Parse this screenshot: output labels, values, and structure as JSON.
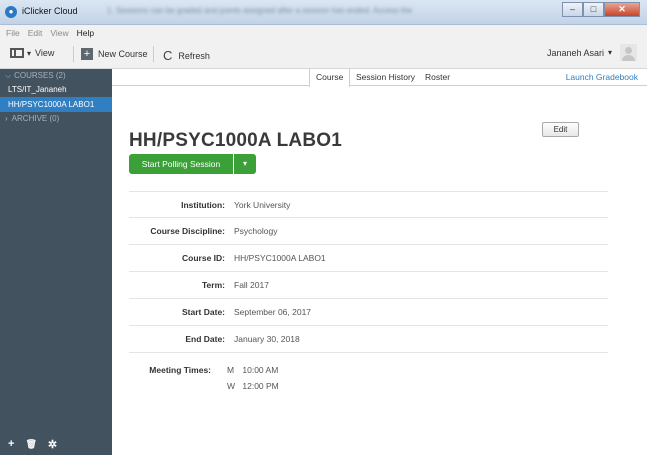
{
  "window": {
    "title": "iClicker Cloud",
    "app_icon": "iclicker-logo-icon",
    "blurred_notice": "1. Sessions can be graded and points assigned after a session has ended. Access the",
    "minimize": "‒",
    "maximize": "□",
    "close": "✕"
  },
  "menu": [
    "File",
    "Edit",
    "View",
    "Help"
  ],
  "toolbar": {
    "view_label": "View",
    "view_caret": "▾",
    "new_course_label": "New Course",
    "new_course_icon": "+",
    "refresh_label": "Refresh",
    "refresh_icon": "C",
    "user_name": "Jananeh Asari",
    "user_caret": "▾"
  },
  "sidebar": {
    "courses_header": "COURSES (2)",
    "courses_caret": "⌵",
    "items": [
      {
        "label": "LTS/IT_Jananeh",
        "selected": false
      },
      {
        "label": "HH/PSYC1000A LABO1",
        "selected": true
      }
    ],
    "archive_header": "ARCHIVE (0)",
    "archive_caret": "›",
    "footer_add": "+",
    "footer_delete": "🗑",
    "footer_settings": "✲"
  },
  "tabs": {
    "course": "Course",
    "session_history": "Session History",
    "roster": "Roster",
    "launch_gradebook": "Launch Gradebook"
  },
  "course": {
    "title": "HH/PSYC1000A LABO1",
    "edit_label": "Edit",
    "poll_label": "Start Polling Session",
    "poll_caret": "▾",
    "details": [
      {
        "label": "Institution:",
        "value": "York University"
      },
      {
        "label": "Course Discipline:",
        "value": "Psychology"
      },
      {
        "label": "Course ID:",
        "value": "HH/PSYC1000A LABO1"
      },
      {
        "label": "Term:",
        "value": "Fall 2017"
      },
      {
        "label": "Start Date:",
        "value": "September 06, 2017"
      },
      {
        "label": "End Date:",
        "value": "January 30, 2018"
      }
    ],
    "meeting_label": "Meeting Times:",
    "meetings": [
      {
        "day": "M",
        "time": "10:00 AM"
      },
      {
        "day": "W",
        "time": "12:00 PM"
      }
    ]
  },
  "colors": {
    "sidebar_bg": "#43525f",
    "selected_bg": "#2f7fc2",
    "poll_green": "#3aa037",
    "link_blue": "#2f7fc2"
  }
}
